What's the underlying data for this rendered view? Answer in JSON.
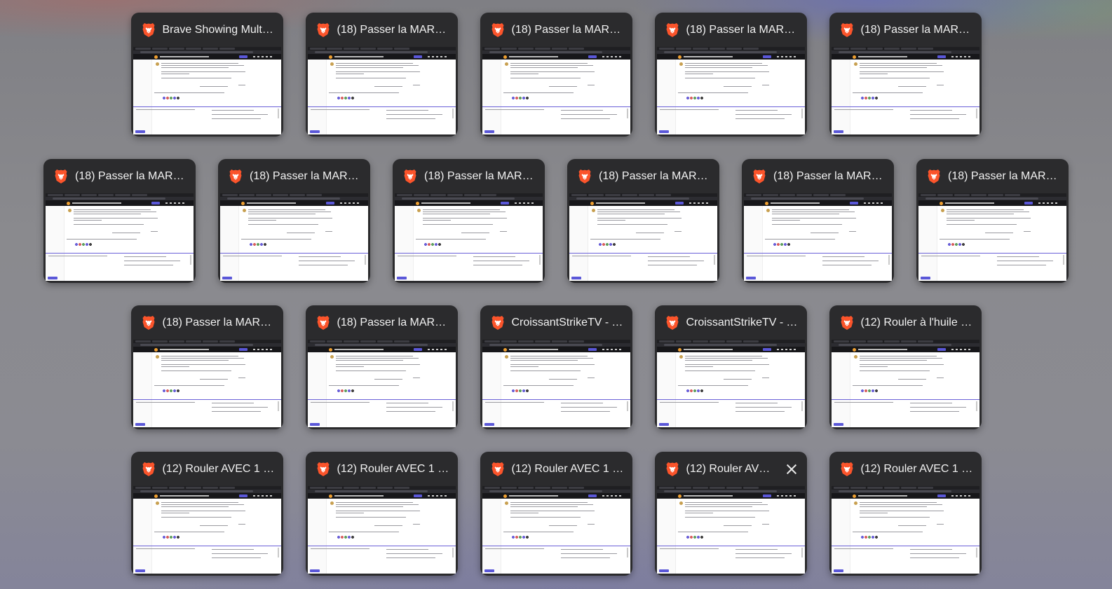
{
  "overview": {
    "rows": [
      {
        "windows": [
          {
            "title": "Brave Showing Multip...",
            "icon": "brave-lion-icon"
          },
          {
            "title": "(18) Passer la MARCH...",
            "icon": "brave-lion-icon"
          },
          {
            "title": "(18) Passer la MARCH...",
            "icon": "brave-lion-icon"
          },
          {
            "title": "(18) Passer la MARCH...",
            "icon": "brave-lion-icon"
          },
          {
            "title": "(18) Passer la MARCH...",
            "icon": "brave-lion-icon"
          }
        ]
      },
      {
        "windows": [
          {
            "title": "(18) Passer la MARCH...",
            "icon": "brave-lion-icon"
          },
          {
            "title": "(18) Passer la MARCH...",
            "icon": "brave-lion-icon"
          },
          {
            "title": "(18) Passer la MARCH...",
            "icon": "brave-lion-icon"
          },
          {
            "title": "(18) Passer la MARCH...",
            "icon": "brave-lion-icon"
          },
          {
            "title": "(18) Passer la MARCH...",
            "icon": "brave-lion-icon"
          },
          {
            "title": "(18) Passer la MARCH...",
            "icon": "brave-lion-icon"
          }
        ]
      },
      {
        "windows": [
          {
            "title": "(18) Passer la MARCH...",
            "icon": "brave-lion-icon"
          },
          {
            "title": "(18) Passer la MARCH...",
            "icon": "brave-lion-icon"
          },
          {
            "title": "CroissantStrikeTV - T...",
            "icon": "brave-lion-icon"
          },
          {
            "title": "CroissantStrikeTV - T...",
            "icon": "brave-lion-icon"
          },
          {
            "title": "(12) Rouler à l'huile d'...",
            "icon": "brave-lion-icon"
          }
        ]
      },
      {
        "windows": [
          {
            "title": "(12) Rouler AVEC 1 CY...",
            "icon": "brave-lion-icon"
          },
          {
            "title": "(12) Rouler AVEC 1 CY...",
            "icon": "brave-lion-icon"
          },
          {
            "title": "(12) Rouler AVEC 1 CY...",
            "icon": "brave-lion-icon"
          },
          {
            "title": "(12) Rouler AVEC...",
            "icon": "brave-lion-icon",
            "hovered": true
          },
          {
            "title": "(12) Rouler AVEC 1 CY...",
            "icon": "brave-lion-icon"
          }
        ]
      }
    ]
  },
  "colors": {
    "card_background": "#2b2b2d",
    "brave_orange": "#fb542b",
    "title_text": "#f2f2f2"
  }
}
